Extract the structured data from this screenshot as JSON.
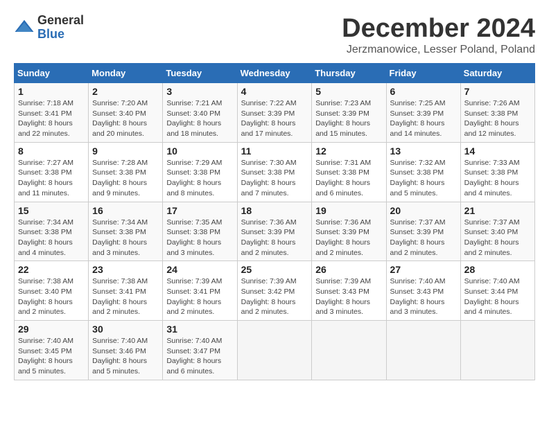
{
  "logo": {
    "general": "General",
    "blue": "Blue"
  },
  "header": {
    "month": "December 2024",
    "subtitle": "Jerzmanowice, Lesser Poland, Poland"
  },
  "days_of_week": [
    "Sunday",
    "Monday",
    "Tuesday",
    "Wednesday",
    "Thursday",
    "Friday",
    "Saturday"
  ],
  "weeks": [
    [
      {
        "day": "1",
        "info": "Sunrise: 7:18 AM\nSunset: 3:41 PM\nDaylight: 8 hours and 22 minutes."
      },
      {
        "day": "2",
        "info": "Sunrise: 7:20 AM\nSunset: 3:40 PM\nDaylight: 8 hours and 20 minutes."
      },
      {
        "day": "3",
        "info": "Sunrise: 7:21 AM\nSunset: 3:40 PM\nDaylight: 8 hours and 18 minutes."
      },
      {
        "day": "4",
        "info": "Sunrise: 7:22 AM\nSunset: 3:39 PM\nDaylight: 8 hours and 17 minutes."
      },
      {
        "day": "5",
        "info": "Sunrise: 7:23 AM\nSunset: 3:39 PM\nDaylight: 8 hours and 15 minutes."
      },
      {
        "day": "6",
        "info": "Sunrise: 7:25 AM\nSunset: 3:39 PM\nDaylight: 8 hours and 14 minutes."
      },
      {
        "day": "7",
        "info": "Sunrise: 7:26 AM\nSunset: 3:38 PM\nDaylight: 8 hours and 12 minutes."
      }
    ],
    [
      {
        "day": "8",
        "info": "Sunrise: 7:27 AM\nSunset: 3:38 PM\nDaylight: 8 hours and 11 minutes."
      },
      {
        "day": "9",
        "info": "Sunrise: 7:28 AM\nSunset: 3:38 PM\nDaylight: 8 hours and 9 minutes."
      },
      {
        "day": "10",
        "info": "Sunrise: 7:29 AM\nSunset: 3:38 PM\nDaylight: 8 hours and 8 minutes."
      },
      {
        "day": "11",
        "info": "Sunrise: 7:30 AM\nSunset: 3:38 PM\nDaylight: 8 hours and 7 minutes."
      },
      {
        "day": "12",
        "info": "Sunrise: 7:31 AM\nSunset: 3:38 PM\nDaylight: 8 hours and 6 minutes."
      },
      {
        "day": "13",
        "info": "Sunrise: 7:32 AM\nSunset: 3:38 PM\nDaylight: 8 hours and 5 minutes."
      },
      {
        "day": "14",
        "info": "Sunrise: 7:33 AM\nSunset: 3:38 PM\nDaylight: 8 hours and 4 minutes."
      }
    ],
    [
      {
        "day": "15",
        "info": "Sunrise: 7:34 AM\nSunset: 3:38 PM\nDaylight: 8 hours and 4 minutes."
      },
      {
        "day": "16",
        "info": "Sunrise: 7:34 AM\nSunset: 3:38 PM\nDaylight: 8 hours and 3 minutes."
      },
      {
        "day": "17",
        "info": "Sunrise: 7:35 AM\nSunset: 3:38 PM\nDaylight: 8 hours and 3 minutes."
      },
      {
        "day": "18",
        "info": "Sunrise: 7:36 AM\nSunset: 3:39 PM\nDaylight: 8 hours and 2 minutes."
      },
      {
        "day": "19",
        "info": "Sunrise: 7:36 AM\nSunset: 3:39 PM\nDaylight: 8 hours and 2 minutes."
      },
      {
        "day": "20",
        "info": "Sunrise: 7:37 AM\nSunset: 3:39 PM\nDaylight: 8 hours and 2 minutes."
      },
      {
        "day": "21",
        "info": "Sunrise: 7:37 AM\nSunset: 3:40 PM\nDaylight: 8 hours and 2 minutes."
      }
    ],
    [
      {
        "day": "22",
        "info": "Sunrise: 7:38 AM\nSunset: 3:40 PM\nDaylight: 8 hours and 2 minutes."
      },
      {
        "day": "23",
        "info": "Sunrise: 7:38 AM\nSunset: 3:41 PM\nDaylight: 8 hours and 2 minutes."
      },
      {
        "day": "24",
        "info": "Sunrise: 7:39 AM\nSunset: 3:41 PM\nDaylight: 8 hours and 2 minutes."
      },
      {
        "day": "25",
        "info": "Sunrise: 7:39 AM\nSunset: 3:42 PM\nDaylight: 8 hours and 2 minutes."
      },
      {
        "day": "26",
        "info": "Sunrise: 7:39 AM\nSunset: 3:43 PM\nDaylight: 8 hours and 3 minutes."
      },
      {
        "day": "27",
        "info": "Sunrise: 7:40 AM\nSunset: 3:43 PM\nDaylight: 8 hours and 3 minutes."
      },
      {
        "day": "28",
        "info": "Sunrise: 7:40 AM\nSunset: 3:44 PM\nDaylight: 8 hours and 4 minutes."
      }
    ],
    [
      {
        "day": "29",
        "info": "Sunrise: 7:40 AM\nSunset: 3:45 PM\nDaylight: 8 hours and 5 minutes."
      },
      {
        "day": "30",
        "info": "Sunrise: 7:40 AM\nSunset: 3:46 PM\nDaylight: 8 hours and 5 minutes."
      },
      {
        "day": "31",
        "info": "Sunrise: 7:40 AM\nSunset: 3:47 PM\nDaylight: 8 hours and 6 minutes."
      },
      {
        "day": "",
        "info": ""
      },
      {
        "day": "",
        "info": ""
      },
      {
        "day": "",
        "info": ""
      },
      {
        "day": "",
        "info": ""
      }
    ]
  ]
}
